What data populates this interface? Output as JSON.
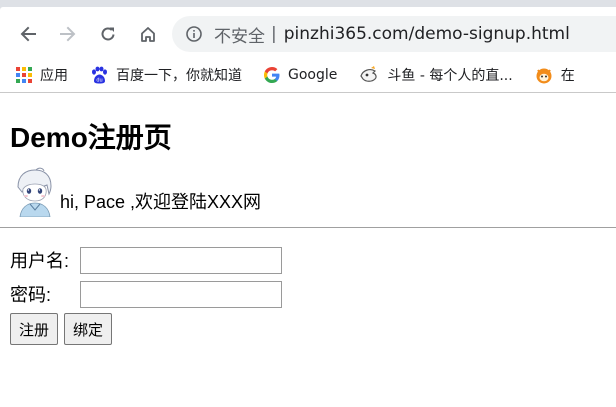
{
  "browser": {
    "address_bar": {
      "security_label": "不安全",
      "separator": "|",
      "url": "pinzhi365.com/demo-signup.html"
    },
    "bookmarks": [
      {
        "label": "应用",
        "icon": "apps-grid-icon"
      },
      {
        "label": "百度一下，你就知道",
        "icon": "baidu-paw-icon"
      },
      {
        "label": "Google",
        "icon": "google-g-icon"
      },
      {
        "label": "斗鱼 - 每个人的直...",
        "icon": "douyu-fish-icon"
      },
      {
        "label": "在",
        "icon": "orange-fox-icon"
      }
    ]
  },
  "page": {
    "title": "Demo注册页",
    "welcome": "hi, Pace ,欢迎登陆XXX网"
  },
  "form": {
    "username_label": "用户名:",
    "username_value": "",
    "password_label": "密码:",
    "password_value": "",
    "register_label": "注册",
    "bind_label": "绑定"
  },
  "colors": {
    "chrome_bg": "#dee1e6",
    "omnibox_bg": "#f1f3f4",
    "text_secondary": "#5f6368",
    "divider": "#a0a0a0"
  }
}
